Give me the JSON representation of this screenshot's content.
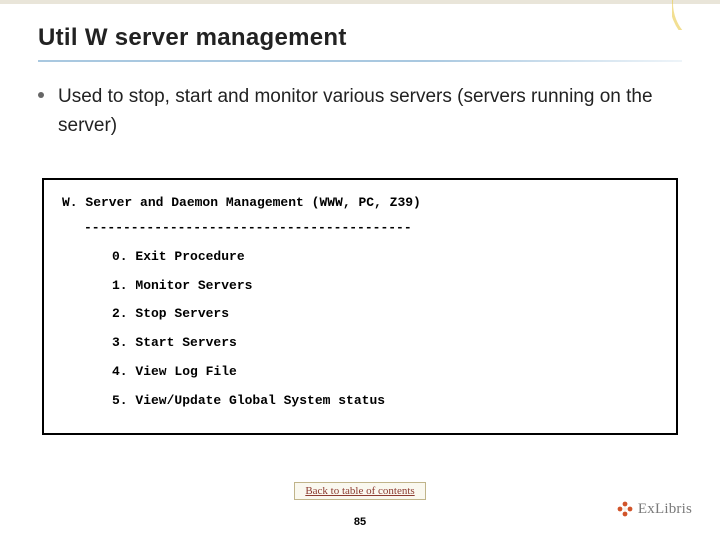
{
  "title": "Util W server management",
  "bullet": "Used to stop, start and monitor various servers (servers running on the server)",
  "menu": {
    "header": "W. Server and Daemon Management (WWW, PC, Z39)",
    "separator": "------------------------------------------",
    "items": [
      "0. Exit Procedure",
      "1. Monitor Servers",
      "2. Stop Servers",
      "3. Start Servers",
      "4. View Log File",
      "5. View/Update Global System status"
    ]
  },
  "toc_link": "Back to table of contents",
  "page_number": "85",
  "logo_text": "ExLibris"
}
